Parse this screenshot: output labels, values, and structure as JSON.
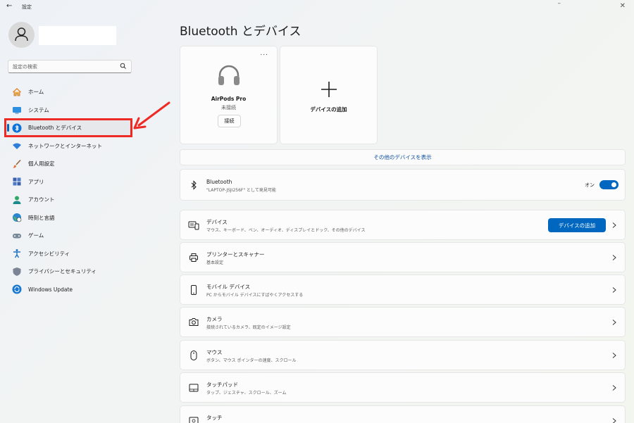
{
  "titlebar": {
    "back": "←",
    "title": "設定",
    "minimize": "–",
    "close": "✕"
  },
  "user": {
    "name": ""
  },
  "search": {
    "placeholder": "設定の検索"
  },
  "sidebar": {
    "items": [
      {
        "label": "ホーム",
        "icon": "home-icon"
      },
      {
        "label": "システム",
        "icon": "system-icon"
      },
      {
        "label": "Bluetooth とデバイス",
        "icon": "bluetooth-icon",
        "active": true
      },
      {
        "label": "ネットワークとインターネット",
        "icon": "network-icon"
      },
      {
        "label": "個人用設定",
        "icon": "brush-icon"
      },
      {
        "label": "アプリ",
        "icon": "apps-icon"
      },
      {
        "label": "アカウント",
        "icon": "account-icon"
      },
      {
        "label": "時刻と言語",
        "icon": "globe-clock-icon"
      },
      {
        "label": "ゲーム",
        "icon": "gamepad-icon"
      },
      {
        "label": "アクセシビリティ",
        "icon": "accessibility-icon"
      },
      {
        "label": "プライバシーとセキュリティ",
        "icon": "shield-icon"
      },
      {
        "label": "Windows Update",
        "icon": "update-icon"
      }
    ]
  },
  "main": {
    "title": "Bluetooth とデバイス",
    "device_card": {
      "more": "...",
      "name": "AirPods Pro",
      "status": "未接続",
      "connect_label": "接続"
    },
    "add_card": {
      "label": "デバイスの追加"
    },
    "show_more": "その他のデバイスを表示",
    "bluetooth_row": {
      "title": "Bluetooth",
      "subtitle": "\"LAPTOP-JSJI256F\" として発見可能",
      "toggle_label": "オン",
      "toggle_on": true
    },
    "rows": [
      {
        "title": "デバイス",
        "subtitle": "マウス、キーボード、ペン、オーディオ、ディスプレイとドック、その他のデバイス",
        "icon": "devices-icon",
        "button": "デバイスの追加"
      },
      {
        "title": "プリンターとスキャナー",
        "subtitle": "基本設定",
        "icon": "printer-icon"
      },
      {
        "title": "モバイル デバイス",
        "subtitle": "PC からモバイル デバイスにすばやくアクセスする",
        "icon": "phone-icon"
      },
      {
        "title": "カメラ",
        "subtitle": "接続されているカメラ、既定のイメージ設定",
        "icon": "camera-icon"
      },
      {
        "title": "マウス",
        "subtitle": "ボタン、マウス ポインターの速度、スクロール",
        "icon": "mouse-icon"
      },
      {
        "title": "タッチパッド",
        "subtitle": "タップ、ジェスチャ、スクロール、ズーム",
        "icon": "touchpad-icon"
      },
      {
        "title": "タッチ",
        "subtitle": "",
        "icon": "touch-icon"
      }
    ]
  },
  "colors": {
    "accent": "#0067c0",
    "highlight": "#ee2a24"
  }
}
